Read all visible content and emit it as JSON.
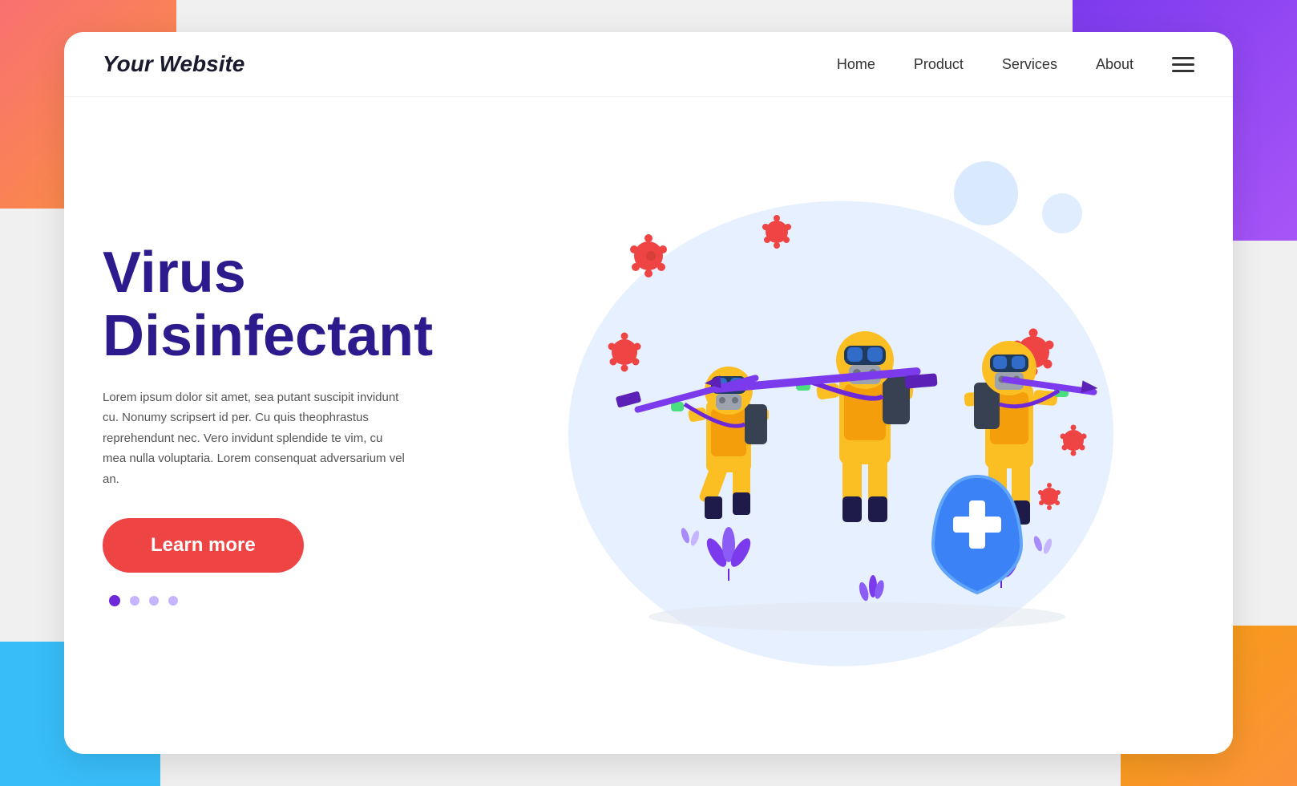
{
  "header": {
    "logo": "Your Website",
    "nav": {
      "home": "Home",
      "product": "Product",
      "services": "Services",
      "about": "About"
    }
  },
  "hero": {
    "title_line1": "Virus",
    "title_line2": "Disinfectant",
    "description": "Lorem ipsum dolor sit amet, sea putant suscipit invidunt cu. Nonumy scripsert id per. Cu quis theophrastus reprehendunt nec. Vero invidunt splendide te vim, cu mea nulla voluptaria. Lorem consenquat adversarium vel an.",
    "cta_button": "Learn more"
  },
  "dots": [
    {
      "active": true
    },
    {
      "active": false
    },
    {
      "active": false
    },
    {
      "active": false
    }
  ],
  "colors": {
    "accent_purple": "#2d1b8e",
    "cta_red": "#ef4444",
    "hazmat_yellow": "#fbbf24",
    "virus_red": "#ef4444",
    "shield_blue": "#3b82f6"
  }
}
